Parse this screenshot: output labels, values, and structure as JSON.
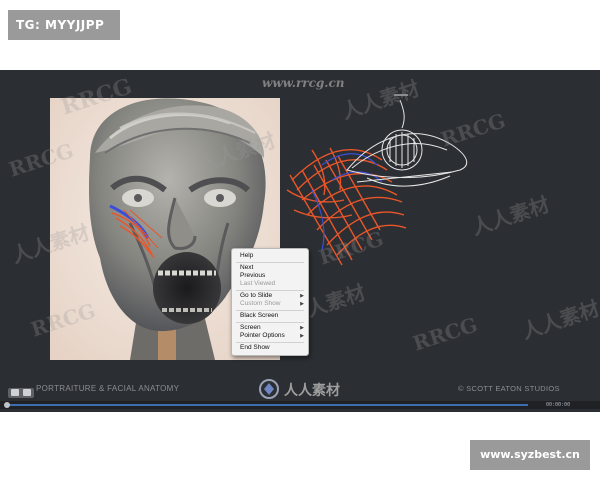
{
  "top_tag": {
    "text": "TG: MYYJJPP"
  },
  "bottom_tag": {
    "text": "www.syzbest.cn"
  },
  "watermarks": {
    "site": "www.rrcg.cn",
    "brand": "RRCG",
    "cn": "人人素材"
  },
  "slide": {
    "footer_left": "PORTRAITURE & FACIAL ANATOMY",
    "footer_right": "© SCOTT EATON STUDIOS",
    "center_logo_text": "人人素材"
  },
  "context_menu": {
    "items": [
      {
        "label": "Help",
        "enabled": true,
        "submenu": false
      },
      {
        "label": "Next",
        "enabled": true,
        "submenu": false
      },
      {
        "label": "Previous",
        "enabled": true,
        "submenu": false
      },
      {
        "label": "Last Viewed",
        "enabled": false,
        "submenu": false
      },
      {
        "label": "Go to Slide",
        "enabled": true,
        "submenu": true
      },
      {
        "label": "Custom Show",
        "enabled": false,
        "submenu": true
      },
      {
        "label": "Black Screen",
        "enabled": true,
        "submenu": false
      },
      {
        "label": "Screen",
        "enabled": true,
        "submenu": true
      },
      {
        "label": "Pointer Options",
        "enabled": true,
        "submenu": true
      },
      {
        "label": "End Show",
        "enabled": true,
        "submenu": false
      }
    ]
  },
  "player": {
    "time": "00:00:00",
    "progress": 0.01
  },
  "colors": {
    "slide_bg": "#2b2e32",
    "annotation_orange": "#e8562a",
    "annotation_blue": "#3a4fd6",
    "sketch_white": "#e6e6e6"
  },
  "icons": [
    "submenu-arrow-icon",
    "playhead-icon",
    "slide-nav-icon"
  ]
}
